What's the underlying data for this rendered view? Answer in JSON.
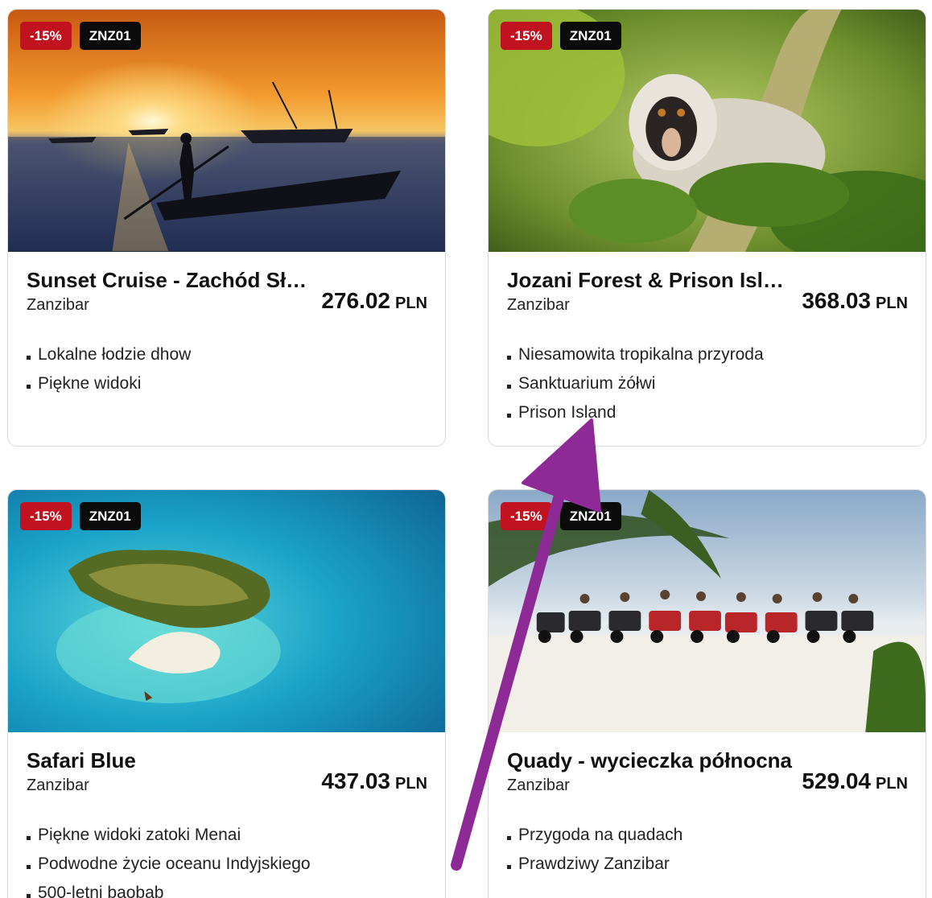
{
  "cards": [
    {
      "discount": "-15%",
      "code": "ZNZ01",
      "title": "Sunset Cruise - Zachód Słońca",
      "location": "Zanzibar",
      "price": "276.02",
      "currency": "PLN",
      "features": [
        "Lokalne łodzie dhow",
        "Piękne widoki"
      ]
    },
    {
      "discount": "-15%",
      "code": "ZNZ01",
      "title": "Jozani Forest & Prison Island",
      "location": "Zanzibar",
      "price": "368.03",
      "currency": "PLN",
      "features": [
        "Niesamowita tropikalna przyroda",
        "Sanktuarium żółwi",
        "Prison Island"
      ]
    },
    {
      "discount": "-15%",
      "code": "ZNZ01",
      "title": "Safari Blue",
      "location": "Zanzibar",
      "price": "437.03",
      "currency": "PLN",
      "features": [
        "Piękne widoki zatoki Menai",
        "Podwodne życie oceanu Indyjskiego",
        "500-letni baobab"
      ]
    },
    {
      "discount": "-15%",
      "code": "ZNZ01",
      "title": "Quady - wycieczka północna",
      "location": "Zanzibar",
      "price": "529.04",
      "currency": "PLN",
      "features": [
        "Przygoda na quadach",
        "Prawdziwy Zanzibar"
      ]
    }
  ],
  "colors": {
    "discount_badge": "#c1121f",
    "code_badge": "#0b0b0b",
    "annotation_arrow": "#8e2a96"
  }
}
